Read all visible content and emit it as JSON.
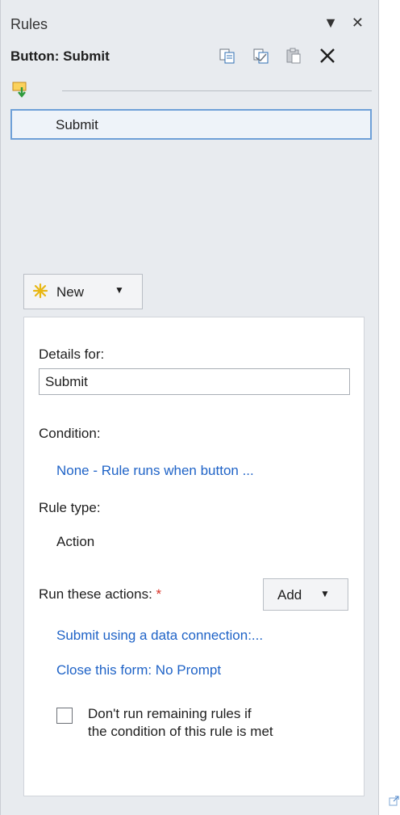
{
  "titlebar": {
    "title": "Rules",
    "controls": "▼ ✕"
  },
  "header": {
    "label": "Button: Submit",
    "toolbar": [
      "copy-icon",
      "copy-all-icon",
      "paste-icon",
      "delete-icon"
    ]
  },
  "rules_list": {
    "items": [
      {
        "label": "Submit",
        "selected": true
      }
    ]
  },
  "new_button": {
    "label": "New"
  },
  "details": {
    "details_for_label": "Details for:",
    "name_value": "Submit",
    "condition_label": "Condition:",
    "condition_value": "None - Rule runs when button ...",
    "rule_type_label": "Rule type:",
    "rule_type_value": "Action",
    "actions_label": "Run these actions:",
    "required_mark": "*",
    "add_button": "Add",
    "actions": [
      "Submit using a data connection:...",
      "Close this form: No Prompt"
    ],
    "checkbox": {
      "checked": false,
      "line1": "Don't run remaining rules if",
      "line2": "the condition of this rule is met"
    }
  },
  "colors": {
    "pane_bg": "#e8ebef",
    "link": "#1f63c7",
    "selection_border": "#6ea0d8",
    "required": "#d93025"
  }
}
